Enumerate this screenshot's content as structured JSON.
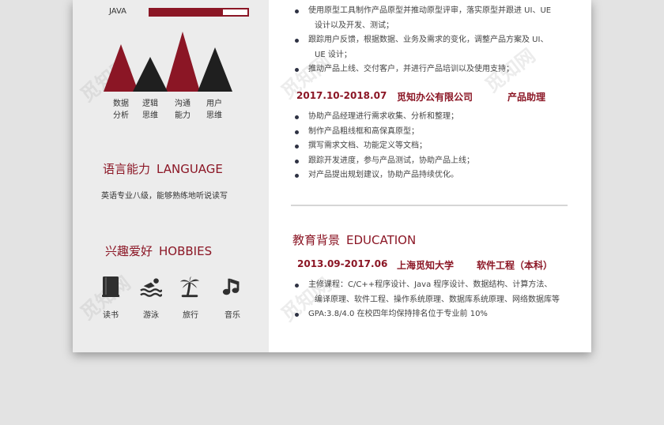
{
  "colors": {
    "accent": "#8b1625",
    "dark": "#1f1f1f",
    "sidebar_bg": "#ececec",
    "page_bg": "#e3e3e3"
  },
  "skills": [
    {
      "label": "JAVA",
      "level": 0.75
    }
  ],
  "chart_data": {
    "type": "area",
    "categories": [
      "数据分析",
      "逻辑思维",
      "沟通能力",
      "用户思维"
    ],
    "values": [
      75,
      55,
      95,
      70
    ],
    "colors": [
      "#8b1625",
      "#1f1f1f",
      "#8b1625",
      "#1f1f1f"
    ]
  },
  "chart_labels": [
    [
      "数据",
      "分析"
    ],
    [
      "逻辑",
      "思维"
    ],
    [
      "沟通",
      "能力"
    ],
    [
      "用户",
      "思维"
    ]
  ],
  "language": {
    "title_cn": "语言能力",
    "title_en": "LANGUAGE",
    "text": "英语专业八级，能够熟练地听说读写"
  },
  "hobbies": {
    "title_cn": "兴趣爱好",
    "title_en": "HOBBIES",
    "items": [
      {
        "label": "读书",
        "icon": "book-icon"
      },
      {
        "label": "游泳",
        "icon": "swim-icon"
      },
      {
        "label": "旅行",
        "icon": "palm-tree-icon"
      },
      {
        "label": "音乐",
        "icon": "music-note-icon"
      }
    ]
  },
  "experience": {
    "first_job_bullets": [
      "使用原型工具制作产品原型并推动原型评审，落实原型并跟进 UI、UE",
      "设计以及开发、测试；",
      "跟踪用户反馈，根据数据、业务及需求的变化，调整产品方案及 UI、",
      "UE 设计；",
      "推动产品上线、交付客户，并进行产品培训以及使用支持；"
    ],
    "second_job": {
      "period": "2017.10-2018.07",
      "company": "觅知办公有限公司",
      "role": "产品助理",
      "bullets": [
        "协助产品经理进行需求收集、分析和整理；",
        "制作产品粗线框和高保真原型；",
        "撰写需求文档、功能定义等文档；",
        "跟踪开发进度，参与产品测试，协助产品上线；",
        "对产品提出规划建议，协助产品持续优化。"
      ]
    }
  },
  "education": {
    "title_cn": "教育背景",
    "title_en": "EDUCATION",
    "period": "2013.09-2017.06",
    "school": "上海觅知大学",
    "major": "软件工程（本科）",
    "bullets": [
      "主修课程：C/C++程序设计、Java 程序设计、数据结构、计算方法、",
      "编译原理、软件工程、操作系统原理、数据库系统原理、网络数据库等",
      "GPA:3.8/4.0 在校四年均保持排名位于专业前 10%"
    ]
  },
  "watermark": "觅知网"
}
